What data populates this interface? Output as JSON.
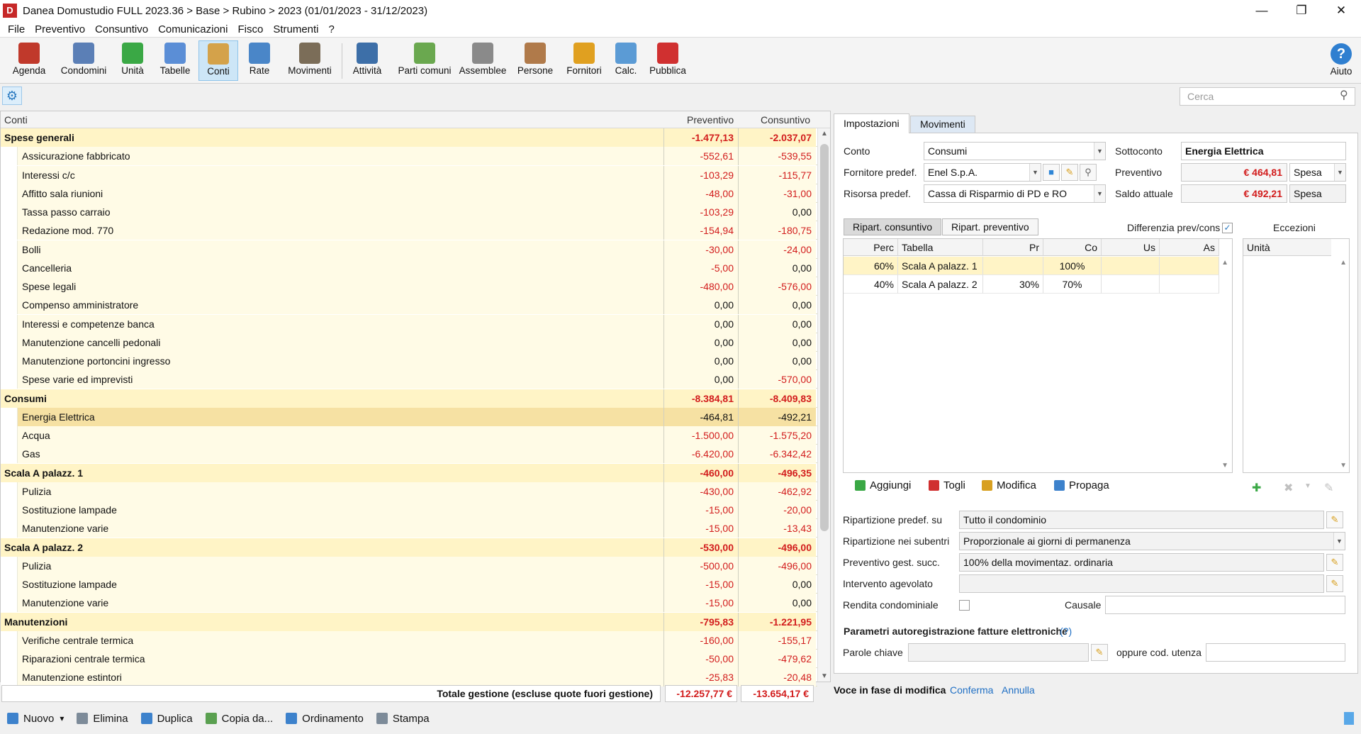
{
  "window": {
    "title": "Danea Domustudio FULL 2023.36 > Base > Rubino > 2023     (01/01/2023 - 31/12/2023)",
    "logo": "D",
    "minimize": "—",
    "maximize": "❐",
    "close": "✕"
  },
  "menu": [
    "File",
    "Preventivo",
    "Consuntivo",
    "Comunicazioni",
    "Fisco",
    "Strumenti",
    "?"
  ],
  "toolbar": [
    {
      "label": "Agenda",
      "icon": "agenda-icon",
      "color": "#c0392b"
    },
    {
      "label": "Condomini",
      "icon": "building-icon",
      "color": "#5b7fb6"
    },
    {
      "label": "Unità",
      "icon": "units-icon",
      "color": "#3aa845"
    },
    {
      "label": "Tabelle",
      "icon": "table-icon",
      "color": "#5b8ed6"
    },
    {
      "label": "Conti",
      "icon": "accounts-icon",
      "color": "#d4a24a"
    },
    {
      "label": "Rate",
      "icon": "installments-icon",
      "color": "#4a86c8"
    },
    {
      "label": "Movimenti",
      "icon": "movements-icon",
      "color": "#7b6d58"
    },
    {
      "label": "Attività",
      "icon": "activity-icon",
      "color": "#3d6fa8"
    },
    {
      "label": "Parti comuni",
      "icon": "common-parts-icon",
      "color": "#6aa84f"
    },
    {
      "label": "Assemblee",
      "icon": "meetings-icon",
      "color": "#8a8a8a"
    },
    {
      "label": "Persone",
      "icon": "people-icon",
      "color": "#b07a4a"
    },
    {
      "label": "Fornitori",
      "icon": "suppliers-icon",
      "color": "#e0a020"
    },
    {
      "label": "Calc.",
      "icon": "calculator-icon",
      "color": "#5b9bd5"
    },
    {
      "label": "Pubblica",
      "icon": "globe-icon",
      "color": "#d03030"
    }
  ],
  "help": {
    "label": "Aiuto",
    "glyph": "?"
  },
  "search": {
    "placeholder": "Cerca",
    "glyph": "⚲"
  },
  "settings_glyph": "⚙",
  "grid": {
    "headers": {
      "name": "Conti",
      "prev": "Preventivo",
      "cons": "Consuntivo"
    },
    "rows": [
      {
        "type": "group",
        "name": "Spese generali",
        "prev": "-1.477,13",
        "cons": "-2.037,07"
      },
      {
        "type": "item",
        "name": "Assicurazione fabbricato",
        "prev": "-552,61",
        "cons": "-539,55"
      },
      {
        "type": "item",
        "name": "Interessi c/c",
        "prev": "-103,29",
        "cons": "-115,77"
      },
      {
        "type": "item",
        "name": "Affitto sala riunioni",
        "prev": "-48,00",
        "cons": "-31,00"
      },
      {
        "type": "item",
        "name": "Tassa passo carraio",
        "prev": "-103,29",
        "cons": "0,00"
      },
      {
        "type": "item",
        "name": "Redazione mod. 770",
        "prev": "-154,94",
        "cons": "-180,75"
      },
      {
        "type": "item",
        "name": "Bolli",
        "prev": "-30,00",
        "cons": "-24,00"
      },
      {
        "type": "item",
        "name": "Cancelleria",
        "prev": "-5,00",
        "cons": "0,00"
      },
      {
        "type": "item",
        "name": "Spese legali",
        "prev": "-480,00",
        "cons": "-576,00"
      },
      {
        "type": "item",
        "name": "Compenso amministratore",
        "prev": "0,00",
        "cons": "0,00"
      },
      {
        "type": "item",
        "name": "Interessi e competenze banca",
        "prev": "0,00",
        "cons": "0,00"
      },
      {
        "type": "item",
        "name": "Manutenzione cancelli pedonali",
        "prev": "0,00",
        "cons": "0,00"
      },
      {
        "type": "item",
        "name": "Manutenzione portoncini ingresso",
        "prev": "0,00",
        "cons": "0,00"
      },
      {
        "type": "item",
        "name": "Spese varie ed imprevisti",
        "prev": "0,00",
        "cons": "-570,00"
      },
      {
        "type": "group",
        "name": "Consumi",
        "prev": "-8.384,81",
        "cons": "-8.409,83"
      },
      {
        "type": "item",
        "name": "Energia Elettrica",
        "prev": "-464,81",
        "cons": "-492,21",
        "selected": true
      },
      {
        "type": "item",
        "name": "Acqua",
        "prev": "-1.500,00",
        "cons": "-1.575,20"
      },
      {
        "type": "item",
        "name": "Gas",
        "prev": "-6.420,00",
        "cons": "-6.342,42"
      },
      {
        "type": "group",
        "name": "Scala A palazz. 1",
        "prev": "-460,00",
        "cons": "-496,35"
      },
      {
        "type": "item",
        "name": "Pulizia",
        "prev": "-430,00",
        "cons": "-462,92"
      },
      {
        "type": "item",
        "name": "Sostituzione lampade",
        "prev": "-15,00",
        "cons": "-20,00"
      },
      {
        "type": "item",
        "name": "Manutenzione varie",
        "prev": "-15,00",
        "cons": "-13,43"
      },
      {
        "type": "group",
        "name": "Scala A palazz. 2",
        "prev": "-530,00",
        "cons": "-496,00"
      },
      {
        "type": "item",
        "name": "Pulizia",
        "prev": "-500,00",
        "cons": "-496,00"
      },
      {
        "type": "item",
        "name": "Sostituzione lampade",
        "prev": "-15,00",
        "cons": "0,00"
      },
      {
        "type": "item",
        "name": "Manutenzione varie",
        "prev": "-15,00",
        "cons": "0,00"
      },
      {
        "type": "group",
        "name": "Manutenzioni",
        "prev": "-795,83",
        "cons": "-1.221,95"
      },
      {
        "type": "item",
        "name": "Verifiche centrale termica",
        "prev": "-160,00",
        "cons": "-155,17"
      },
      {
        "type": "item",
        "name": "Riparazioni centrale termica",
        "prev": "-50,00",
        "cons": "-479,62"
      },
      {
        "type": "item",
        "name": "Manutenzione estintori",
        "prev": "-25,83",
        "cons": "-20,48"
      }
    ],
    "total_label": "Totale gestione (escluse quote fuori gestione)",
    "total_prev": "-12.257,77 €",
    "total_cons": "-13.654,17 €"
  },
  "bottom_buttons": [
    {
      "label": "Nuovo",
      "icon": "new-icon",
      "color": "#3d82cc"
    },
    {
      "label": "Elimina",
      "icon": "trash-icon",
      "color": "#7d8b99"
    },
    {
      "label": "Duplica",
      "icon": "duplicate-icon",
      "color": "#3d82cc"
    },
    {
      "label": "Copia da...",
      "icon": "copy-from-icon",
      "color": "#5aa050"
    },
    {
      "label": "Ordinamento",
      "icon": "sort-icon",
      "color": "#3d82cc"
    },
    {
      "label": "Stampa",
      "icon": "print-icon",
      "color": "#7d8b99"
    }
  ],
  "panel": {
    "tabs": [
      "Impostazioni",
      "Movimenti"
    ],
    "conto_label": "Conto",
    "conto": "Consumi",
    "sottoconto_label": "Sottoconto",
    "sottoconto": "Energia Elettrica",
    "fornitore_label": "Fornitore predef.",
    "fornitore": "Enel S.p.A.",
    "preventivo_label": "Preventivo",
    "preventivo": "€ 464,81",
    "preventivo_type": "Spesa",
    "risorsa_label": "Risorsa predef.",
    "risorsa": "Cassa di Risparmio di PD e RO",
    "saldo_label": "Saldo attuale",
    "saldo": "€ 492,21",
    "saldo_type": "Spesa",
    "btn_cons": "Ripart. consuntivo",
    "btn_prev": "Ripart. preventivo",
    "diff_label": "Differenzia prev/cons",
    "eccezioni": "Eccezioni",
    "rip_headers": [
      "Perc",
      "Tabella",
      "Pr",
      "Co",
      "Us",
      "As"
    ],
    "rip_rows": [
      {
        "perc": "60%",
        "tabella": "Scala A palazz. 1",
        "pr": "",
        "co": "100%",
        "us": "",
        "as": ""
      },
      {
        "perc": "40%",
        "tabella": "Scala A palazz. 2",
        "pr": "30%",
        "co": "70%",
        "us": "",
        "as": ""
      }
    ],
    "unit_header": "Unità",
    "actions": [
      "Aggiungi",
      "Togli",
      "Modifica",
      "Propaga"
    ],
    "rip_predef_label": "Ripartizione predef. su",
    "rip_predef": "Tutto il condominio",
    "rip_sub_label": "Ripartizione nei subentri",
    "rip_sub": "Proporzionale ai giorni di permanenza",
    "prev_succ_label": "Preventivo gest. succ.",
    "prev_succ": "100% della movimentaz. ordinaria",
    "intervento_label": "Intervento agevolato",
    "rendita_label": "Rendita condominiale",
    "causale_label": "Causale",
    "params_title": "Parametri autoregistrazione fatture elettroniche",
    "params_help": "(?)",
    "parole_label": "Parole chiave",
    "oppure_label": "oppure cod. utenza"
  },
  "status": {
    "text": "Voce in fase di modifica",
    "confirm": "Conferma",
    "cancel": "Annulla"
  }
}
